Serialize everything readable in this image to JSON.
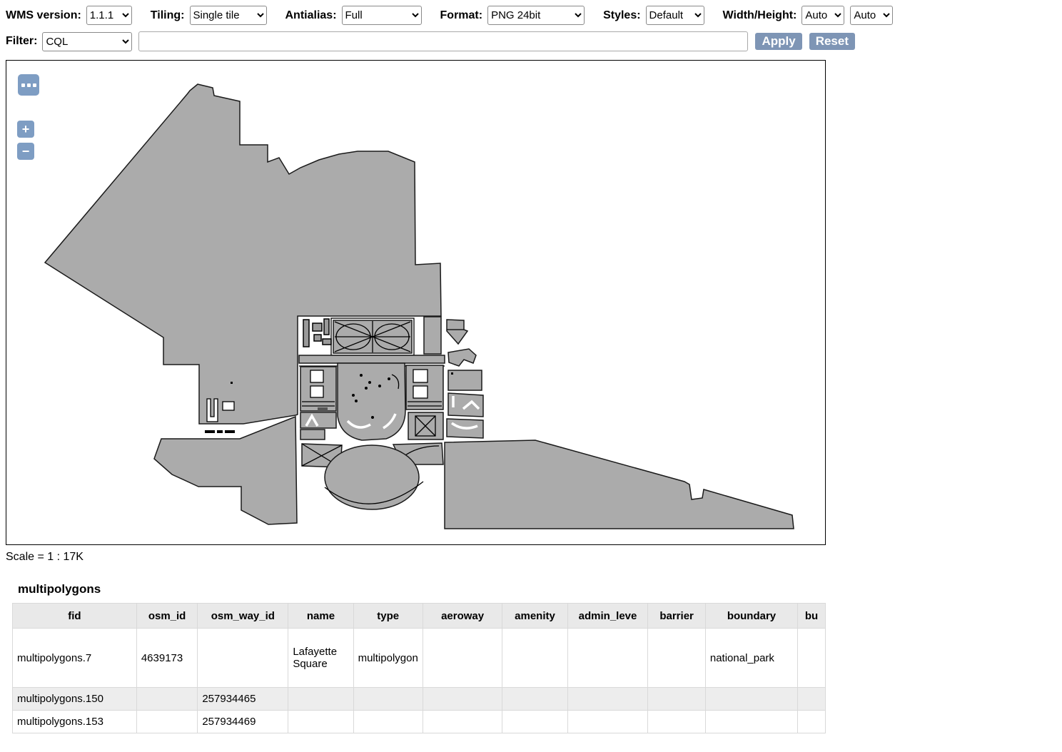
{
  "toolbar": {
    "wms_version_label": "WMS version:",
    "wms_version_value": "1.1.1",
    "tiling_label": "Tiling:",
    "tiling_value": "Single tile",
    "antialias_label": "Antialias:",
    "antialias_value": "Full",
    "format_label": "Format:",
    "format_value": "PNG 24bit",
    "styles_label": "Styles:",
    "styles_value": "Default",
    "width_height_label": "Width/Height:",
    "width_value": "Auto",
    "height_value": "Auto"
  },
  "filter_bar": {
    "filter_label": "Filter:",
    "filter_type_value": "CQL",
    "filter_input_value": "",
    "filter_input_placeholder": "",
    "apply_label": "Apply",
    "reset_label": "Reset"
  },
  "map": {
    "options_icon": "ellipsis-icon",
    "zoom_in_label": "+",
    "zoom_out_label": "−",
    "scale_text": "Scale = 1 : 17K",
    "colors": {
      "polygon_fill": "#ababab",
      "polygon_stroke": "#000000",
      "control_background": "#7e9dc3",
      "button_background": "#7e95b5"
    }
  },
  "table": {
    "title": "multipolygons",
    "columns": [
      "fid",
      "osm_id",
      "osm_way_id",
      "name",
      "type",
      "aeroway",
      "amenity",
      "admin_leve",
      "barrier",
      "boundary",
      "bu"
    ],
    "rows": [
      {
        "cells": [
          "multipolygons.7",
          "4639173",
          "",
          "Lafayette Square",
          "multipolygon",
          "",
          "",
          "",
          "",
          "national_park",
          ""
        ]
      },
      {
        "cells": [
          "multipolygons.150",
          "",
          "257934465",
          "",
          "",
          "",
          "",
          "",
          "",
          "",
          ""
        ]
      },
      {
        "cells": [
          "multipolygons.153",
          "",
          "257934469",
          "",
          "",
          "",
          "",
          "",
          "",
          "",
          ""
        ]
      }
    ]
  }
}
